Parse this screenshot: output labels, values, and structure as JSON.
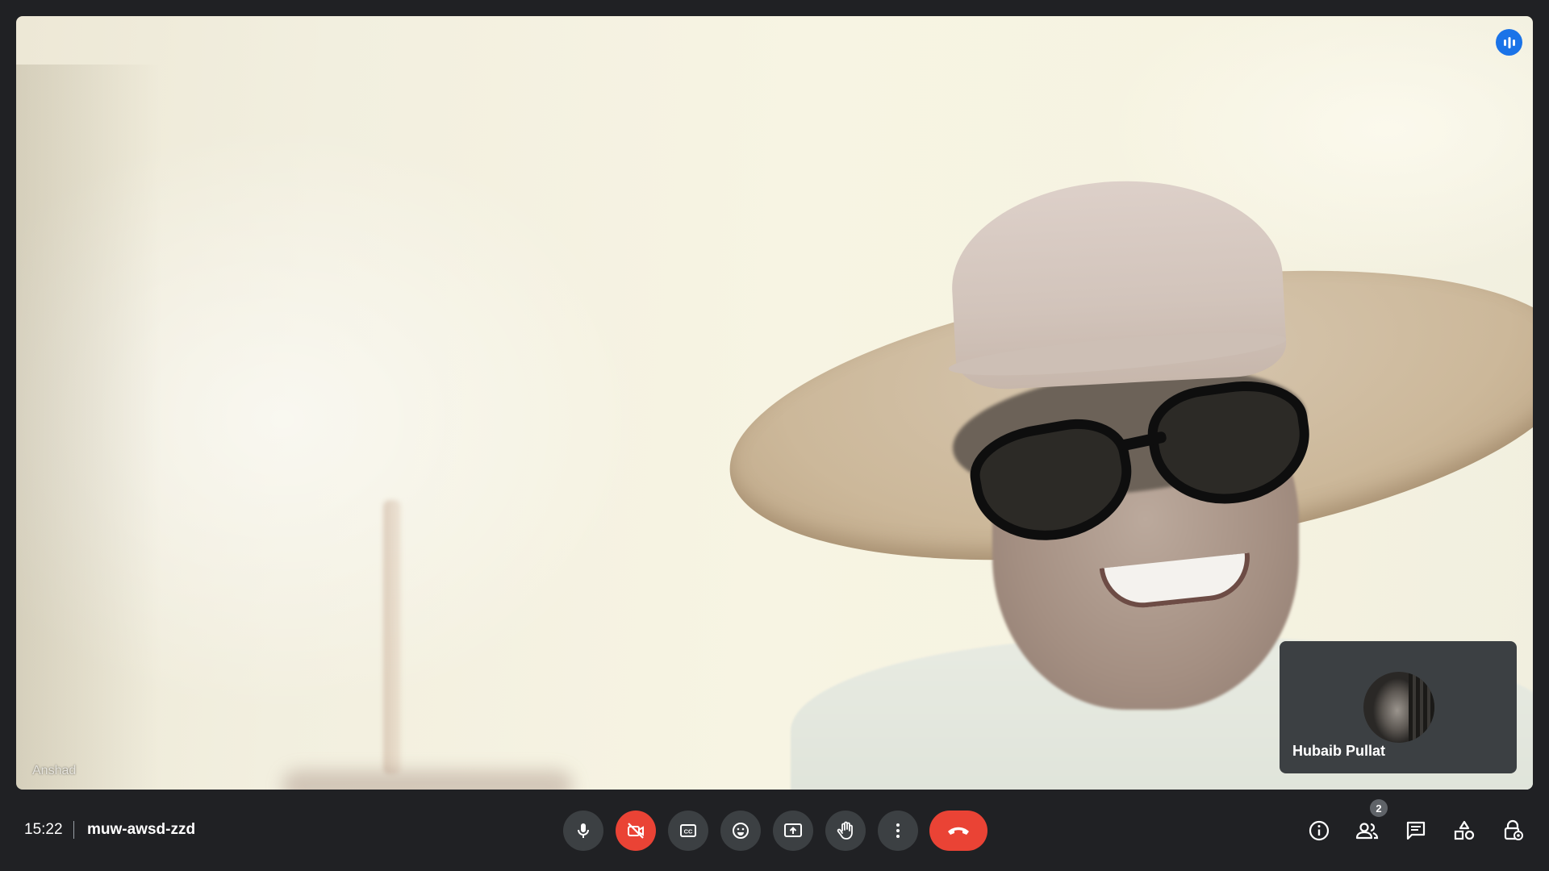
{
  "main_video": {
    "participant_name": "Anshad"
  },
  "pip_tile": {
    "participant_name": "Hubaib Pullat"
  },
  "meeting": {
    "time": "15:22",
    "code": "muw-awsd-zzd"
  },
  "controls": [
    {
      "name": "microphone",
      "icon": "mic-icon",
      "state": "on"
    },
    {
      "name": "camera",
      "icon": "videocam-off-icon",
      "state": "off",
      "color": "#ea4335"
    },
    {
      "name": "captions",
      "icon": "closed-captions-icon"
    },
    {
      "name": "reactions",
      "icon": "emoji-icon"
    },
    {
      "name": "present",
      "icon": "present-screen-icon"
    },
    {
      "name": "raise-hand",
      "icon": "hand-icon"
    },
    {
      "name": "more-options",
      "icon": "more-vert-icon"
    },
    {
      "name": "end-call",
      "icon": "call-end-icon",
      "color": "#ea4335"
    }
  ],
  "side_actions": {
    "people_count": "2",
    "icons": [
      "info-icon",
      "people-icon",
      "chat-icon",
      "activities-icon",
      "host-controls-icon"
    ]
  },
  "colors": {
    "background": "#202124",
    "button": "#3c4043",
    "danger": "#ea4335",
    "accent": "#1a73e8"
  }
}
